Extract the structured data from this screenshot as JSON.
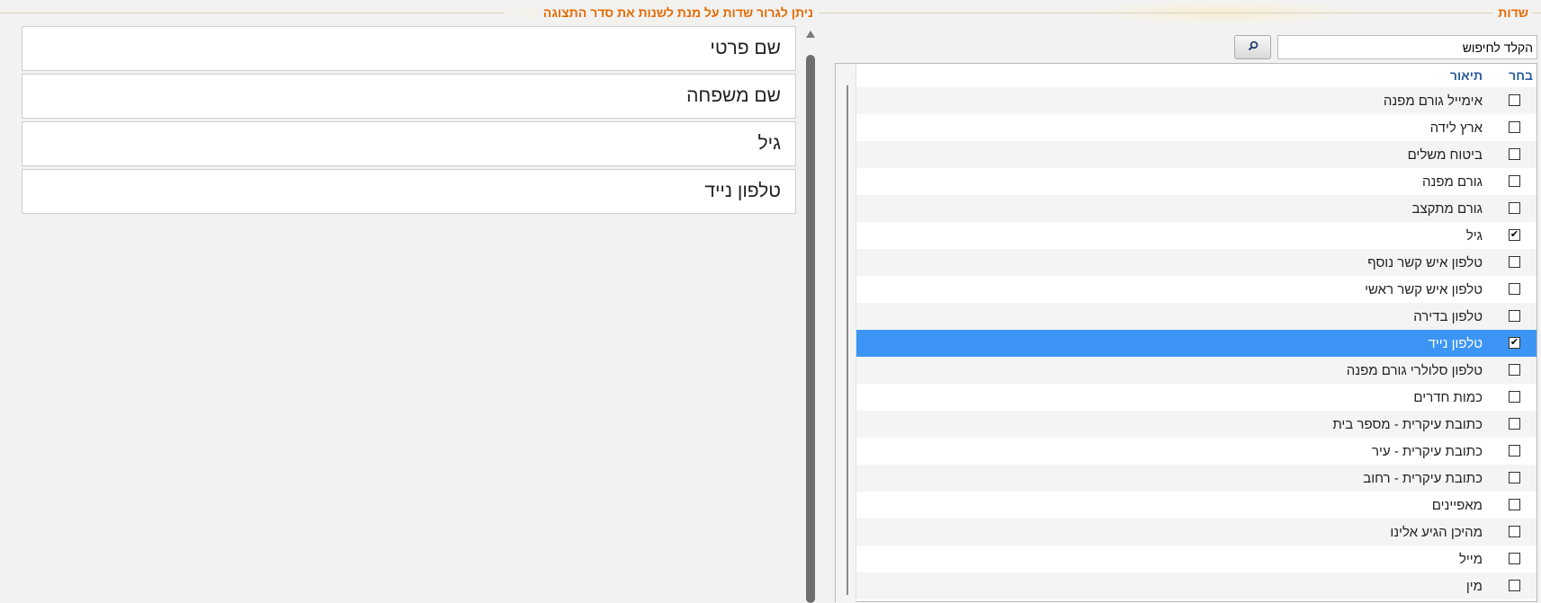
{
  "left_panel": {
    "legend": "ניתן לגרור שדות על מנת לשנות את סדר התצוגה",
    "selected_fields": [
      {
        "label": "שם פרטי"
      },
      {
        "label": "שם משפחה"
      },
      {
        "label": "גיל"
      },
      {
        "label": "טלפון נייד"
      }
    ]
  },
  "right_panel": {
    "legend": "שדות",
    "search": {
      "placeholder": "הקלד לחיפוש",
      "button_icon": "search-icon"
    },
    "grid": {
      "columns": {
        "select": "בחר",
        "description": "תיאור"
      },
      "rows": [
        {
          "label": "אימייל גורם מפנה",
          "checked": false
        },
        {
          "label": "ארץ לידה",
          "checked": false
        },
        {
          "label": "ביטוח משלים",
          "checked": false
        },
        {
          "label": "גורם מפנה",
          "checked": false
        },
        {
          "label": "גורם מתקצב",
          "checked": false
        },
        {
          "label": "גיל",
          "checked": true
        },
        {
          "label": "טלפון איש קשר נוסף",
          "checked": false
        },
        {
          "label": "טלפון איש קשר ראשי",
          "checked": false
        },
        {
          "label": "טלפון בדירה",
          "checked": false
        },
        {
          "label": "טלפון נייד",
          "checked": true,
          "highlighted": true
        },
        {
          "label": "טלפון סלולרי גורם מפנה",
          "checked": false
        },
        {
          "label": "כמות חדרים",
          "checked": false
        },
        {
          "label": "כתובת עיקרית - מספר בית",
          "checked": false
        },
        {
          "label": "כתובת עיקרית - עיר",
          "checked": false
        },
        {
          "label": "כתובת עיקרית - רחוב",
          "checked": false
        },
        {
          "label": "מאפיינים",
          "checked": false
        },
        {
          "label": "מהיכן הגיע אלינו",
          "checked": false
        },
        {
          "label": "מייל",
          "checked": false
        },
        {
          "label": "מין",
          "checked": false
        }
      ]
    }
  },
  "colors": {
    "accent": "#e66a00",
    "header_text": "#2a5d9f",
    "selection": "#3c95f4"
  }
}
